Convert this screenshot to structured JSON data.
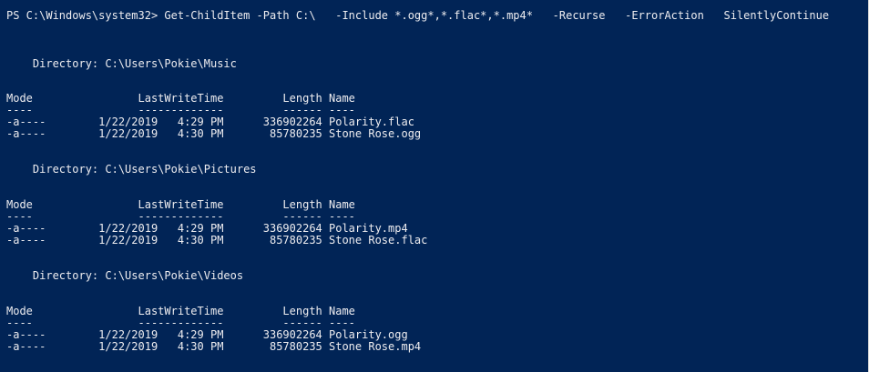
{
  "console": {
    "prompt_line": "PS C:\\Windows\\system32> Get-ChildItem -Path C:\\   -Include *.ogg*,*.flac*,*.mp4*   -Recurse   -ErrorAction   SilentlyContinue",
    "blocks": [
      {
        "directory": "    Directory: C:\\Users\\Pokie\\Music",
        "header": "Mode                LastWriteTime         Length Name",
        "separator": "----                -------------         ------ ----",
        "rows": [
          "-a----        1/22/2019   4:29 PM      336902264 Polarity.flac",
          "-a----        1/22/2019   4:30 PM       85780235 Stone Rose.ogg"
        ]
      },
      {
        "directory": "    Directory: C:\\Users\\Pokie\\Pictures",
        "header": "Mode                LastWriteTime         Length Name",
        "separator": "----                -------------         ------ ----",
        "rows": [
          "-a----        1/22/2019   4:29 PM      336902264 Polarity.mp4",
          "-a----        1/22/2019   4:30 PM       85780235 Stone Rose.flac"
        ]
      },
      {
        "directory": "    Directory: C:\\Users\\Pokie\\Videos",
        "header": "Mode                LastWriteTime         Length Name",
        "separator": "----                -------------         ------ ----",
        "rows": [
          "-a----        1/22/2019   4:29 PM      336902264 Polarity.ogg",
          "-a----        1/22/2019   4:30 PM       85780235 Stone Rose.mp4"
        ]
      }
    ]
  }
}
